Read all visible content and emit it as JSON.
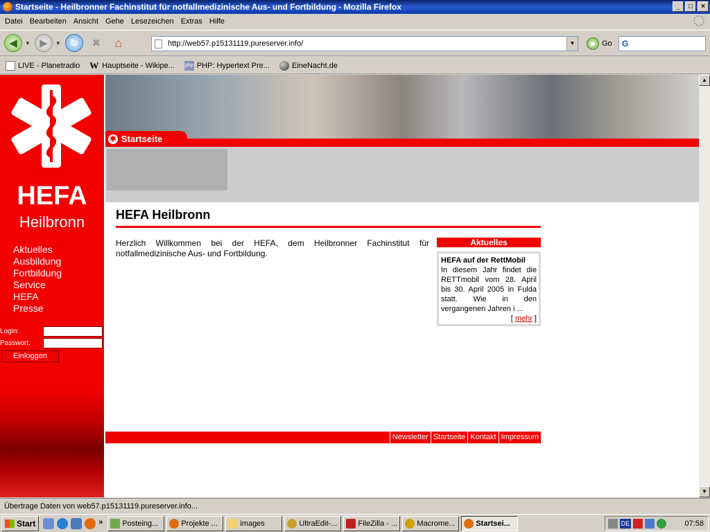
{
  "window": {
    "title": "Startseite - Heilbronner Fachinstitut für notfallmedizinische Aus- und Fortbildung - Mozilla Firefox"
  },
  "menu": [
    "Datei",
    "Bearbeiten",
    "Ansicht",
    "Gehe",
    "Lesezeichen",
    "Extras",
    "Hilfe"
  ],
  "toolbar": {
    "url": "http://web57.p15131119.pureserver.info/",
    "go_label": "Go",
    "search_logo": "G"
  },
  "bookmarks": [
    "LIVE - Planetradio",
    "Hauptseite - Wikipe...",
    "PHP: Hypertext Pre...",
    "EineNacht.de"
  ],
  "site": {
    "brand": "HEFA",
    "city": "Heilbronn",
    "nav": [
      "Aktuelles",
      "Ausbildung",
      "Fortbildung",
      "Service",
      "HEFA",
      "Presse"
    ],
    "login_label": "Login:",
    "password_label": "Passwort:",
    "login_button": "Einloggen",
    "tab_label": "Startseite",
    "page_title": "HEFA Heilbronn",
    "welcome": "Herzlich Willkommen bei der HEFA, dem Heilbronner Fachinstitut für notfallmedizinische Aus- und Fortbildung.",
    "news_header": "Aktuelles",
    "news_title": "HEFA auf der RettMobil",
    "news_text": "In diesem Jahr findet die RETTmobil vom 28. April bis 30. April 2005 in Fulda statt. Wie in den vergangenen Jahren i ...",
    "news_more": "mehr",
    "footer": [
      "Newsletter",
      "Startseite",
      "Kontakt",
      "Impressum"
    ]
  },
  "status": {
    "text": "Übertrage Daten von web57.p15131119.pureserver.info..."
  },
  "taskbar": {
    "start": "Start",
    "quicklaunch_more": "»",
    "buttons": [
      "Posteing...",
      "Projekte ...",
      "images",
      "UltraEdit-...",
      "FileZilla - ...",
      "Macrome...",
      "Startsei..."
    ],
    "tray_lang": "DE",
    "clock": "07:58"
  },
  "colors": {
    "brand_red": "#f20000",
    "title_blue": "#0a246a"
  }
}
